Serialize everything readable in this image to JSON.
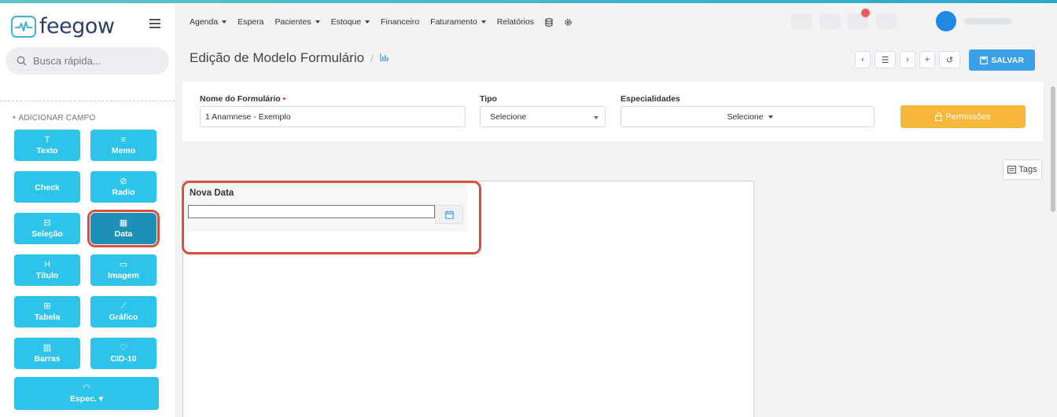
{
  "brand": {
    "name": "feegow",
    "accent": "#3fb6c6"
  },
  "sidebar": {
    "search_placeholder": "Busca rápida...",
    "add_field_label": "+ ADICIONAR CAMPO",
    "fields": [
      {
        "label": "Texto",
        "icon": "T"
      },
      {
        "label": "Memo",
        "icon": "≡"
      },
      {
        "label": "Check",
        "icon": ""
      },
      {
        "label": "Radio",
        "icon": "⊘"
      },
      {
        "label": "Seleção",
        "icon": "⊟"
      },
      {
        "label": "Data",
        "icon": "▦"
      },
      {
        "label": "Título",
        "icon": "H"
      },
      {
        "label": "Imagem",
        "icon": "▭"
      },
      {
        "label": "Tabela",
        "icon": "⊞"
      },
      {
        "label": "Gráfico",
        "icon": "⟋"
      },
      {
        "label": "Barras",
        "icon": "▥"
      },
      {
        "label": "CID-10",
        "icon": "♡"
      },
      {
        "label": "Espec. ▾",
        "icon": "◠"
      }
    ]
  },
  "nav": {
    "items": [
      {
        "label": "Agenda",
        "dropdown": true
      },
      {
        "label": "Espera",
        "dropdown": false
      },
      {
        "label": "Pacientes",
        "dropdown": true
      },
      {
        "label": "Estoque",
        "dropdown": true
      },
      {
        "label": "Financeiro",
        "dropdown": false
      },
      {
        "label": "Faturamento",
        "dropdown": true
      },
      {
        "label": "Relatórios",
        "dropdown": false
      }
    ]
  },
  "header": {
    "title": "Edição de Modelo Formulário",
    "separator": "/",
    "save_label": "SALVAR"
  },
  "form": {
    "name_label": "Nome do Formulário",
    "name_required": "•",
    "name_value": "1 Anamnese - Exemplo",
    "type_label": "Tipo",
    "type_value": "Selecione",
    "specialties_label": "Especialidades",
    "specialties_value": "Selecione",
    "permissions_label": "Permissões"
  },
  "tags_label": "Tags",
  "canvas": {
    "field_label": "Nova Data",
    "field_value": ""
  },
  "colors": {
    "field_button": "#2ec4ea",
    "field_button_active": "#1e8fb6",
    "highlight": "#d9503f",
    "save": "#3aa1e8",
    "permissions": "#f7b73a"
  }
}
